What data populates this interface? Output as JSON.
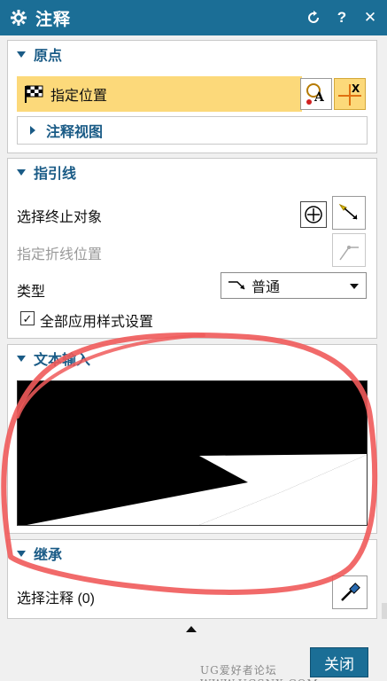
{
  "window": {
    "title": "注释",
    "icons": [
      "gear-icon",
      "reset-icon",
      "help-icon",
      "close-icon"
    ]
  },
  "origin": {
    "header": "原点",
    "specify_location": "指定位置",
    "annotation_view": "注释视图"
  },
  "leader": {
    "header": "指引线",
    "select_terminating_object": "选择终止对象",
    "specify_jog_location": "指定折线位置",
    "type_label": "类型",
    "type_value": "普通",
    "apply_style_label": "全部应用样式设置",
    "apply_style_checked": true
  },
  "text_input": {
    "header": "文本输入"
  },
  "inherit": {
    "header": "继承",
    "select_note": "选择注释 (0)"
  },
  "footer": {
    "close_label": "关闭",
    "watermark": "UG爱好者论坛 WWW.UGSNX.COM"
  },
  "colors": {
    "title_bar": "#1b6e96",
    "highlight": "#fcd97a",
    "section_text": "#1a5b86",
    "annotation_stroke": "#f05a5a"
  }
}
